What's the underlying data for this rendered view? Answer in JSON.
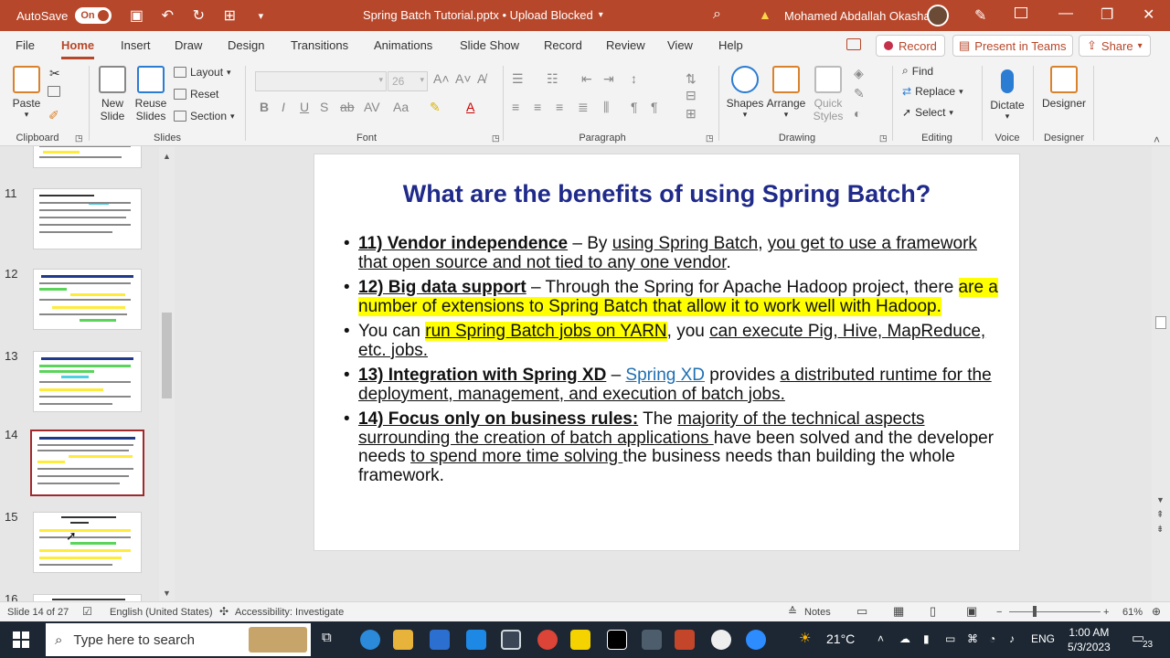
{
  "titlebar": {
    "autosave_label": "AutoSave",
    "autosave_state": "On",
    "doc_title": "Spring Batch Tutorial.pptx • Upload Blocked",
    "user_name": "Mohamed Abdallah Okasha"
  },
  "menu": {
    "tabs": [
      "File",
      "Home",
      "Insert",
      "Draw",
      "Design",
      "Transitions",
      "Animations",
      "Slide Show",
      "Record",
      "Review",
      "View",
      "Help"
    ],
    "active": "Home",
    "record_label": "Record",
    "teams_label": "Present in Teams",
    "share_label": "Share"
  },
  "ribbon": {
    "clipboard": {
      "paste": "Paste",
      "label": "Clipboard"
    },
    "slides": {
      "new_slide_1": "New",
      "new_slide_2": "Slide",
      "reuse_1": "Reuse",
      "reuse_2": "Slides",
      "layout": "Layout",
      "reset": "Reset",
      "section": "Section",
      "label": "Slides"
    },
    "font": {
      "size": "26",
      "label": "Font"
    },
    "paragraph": {
      "label": "Paragraph"
    },
    "drawing": {
      "shapes": "Shapes",
      "arrange": "Arrange",
      "quick_1": "Quick",
      "quick_2": "Styles",
      "label": "Drawing"
    },
    "editing": {
      "find": "Find",
      "replace": "Replace",
      "select": "Select",
      "label": "Editing"
    },
    "voice": {
      "dictate": "Dictate",
      "label": "Voice"
    },
    "designer": {
      "designer": "Designer",
      "label": "Designer"
    }
  },
  "thumbnails": {
    "items": [
      {
        "num": "11",
        "title": "What is a Batch Processing?"
      },
      {
        "num": "12",
        "title": "What are the benefits of using Spring Batch?"
      },
      {
        "num": "13",
        "title": "What are the benefits of using Spring Batch?"
      },
      {
        "num": "14",
        "title": "What are the benefits of using Spring Batch?"
      },
      {
        "num": "15",
        "title": "What are the terminologies used in Spring Batch?"
      },
      {
        "num": "16",
        "title": "What are the terminologies used in Spring"
      }
    ],
    "selected": "14"
  },
  "slide": {
    "title": "What are the benefits of using Spring Batch?",
    "b1_head": "11) Vendor independence",
    "b1_dash": " – By ",
    "b1_u1": "using Spring Batch",
    "b1_comma": ", ",
    "b1_u2": "you get to use a framework that open source and not tied to any one vendor",
    "b1_end": ".",
    "b2_head": "12) Big data support",
    "b2_text": " – Through the Spring for Apache Hadoop project, there ",
    "b2_hl": "are a number of extensions to Spring Batch that allow it to work well with Hadoop.",
    "b3_pre": "You can ",
    "b3_hl": "run Spring Batch jobs on YARN",
    "b3_mid": ", you ",
    "b3_u": "can execute Pig, Hive, MapReduce, etc. jobs.",
    "b4_head": "13) Integration with Spring XD",
    "b4_dash": " – ",
    "b4_link": "Spring XD",
    "b4_mid": " provides ",
    "b4_u": "a distributed runtime for the deployment, management, and execution of batch jobs.",
    "b5_head": "14) Focus only on business rules:",
    "b5_pre": " The ",
    "b5_u1": "majority of the technical aspects surrounding the creation of batch applications ",
    "b5_mid": "have been solved and the developer needs ",
    "b5_u2": "to spend more time solving ",
    "b5_end": "the business needs than building the whole framework."
  },
  "status": {
    "slide_info": "Slide 14 of 27",
    "language": "English (United States)",
    "accessibility": "Accessibility: Investigate",
    "notes": "Notes",
    "zoom": "61%"
  },
  "taskbar": {
    "search_placeholder": "Type here to search",
    "weather": "21°C",
    "lang": "ENG",
    "time": "1:00 AM",
    "date": "5/3/2023",
    "notif_count": "23"
  },
  "colors": {
    "accent": "#b7472a",
    "title_blue": "#1f2a8a",
    "highlight": "#ffff00"
  }
}
